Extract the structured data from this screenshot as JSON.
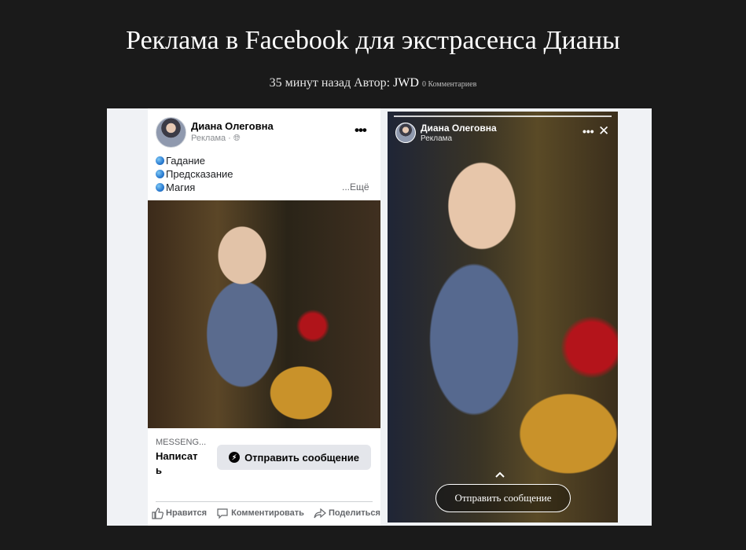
{
  "article": {
    "title": "Реклама в Facebook для экстрасенса Дианы",
    "time": "35 минут назад",
    "author_prefix": "Автор:",
    "author": "JWD",
    "comments": "0 Комментариев"
  },
  "feed_post": {
    "page_name": "Диана Олеговна",
    "sponsored": "Реклама ·",
    "lines": [
      "Гадание",
      "Предсказание",
      "Магия"
    ],
    "see_more": "...Ещё",
    "cta_label": "MESSENG...",
    "cta_title_line1": "Написат",
    "cta_title_line2": "ь",
    "send_button": "Отправить сообщение",
    "actions": {
      "like": "Нравится",
      "comment": "Комментировать",
      "share": "Поделиться"
    }
  },
  "story": {
    "page_name": "Диана Олеговна",
    "sponsored": "Реклама",
    "send_button": "Отправить сообщение"
  },
  "icons": {
    "globe": "globe-emoji-icon",
    "more": "more-dots-icon",
    "messenger": "messenger-icon",
    "like": "thumbs-up-icon",
    "comment": "comment-bubble-icon",
    "share": "share-arrow-icon",
    "close": "close-icon",
    "chevron": "chevron-up-icon"
  },
  "colors": {
    "page_bg": "#1a1a1a",
    "frame_bg": "#f0f2f5",
    "button_bg": "#e4e6eb",
    "muted_text": "#65676b"
  }
}
